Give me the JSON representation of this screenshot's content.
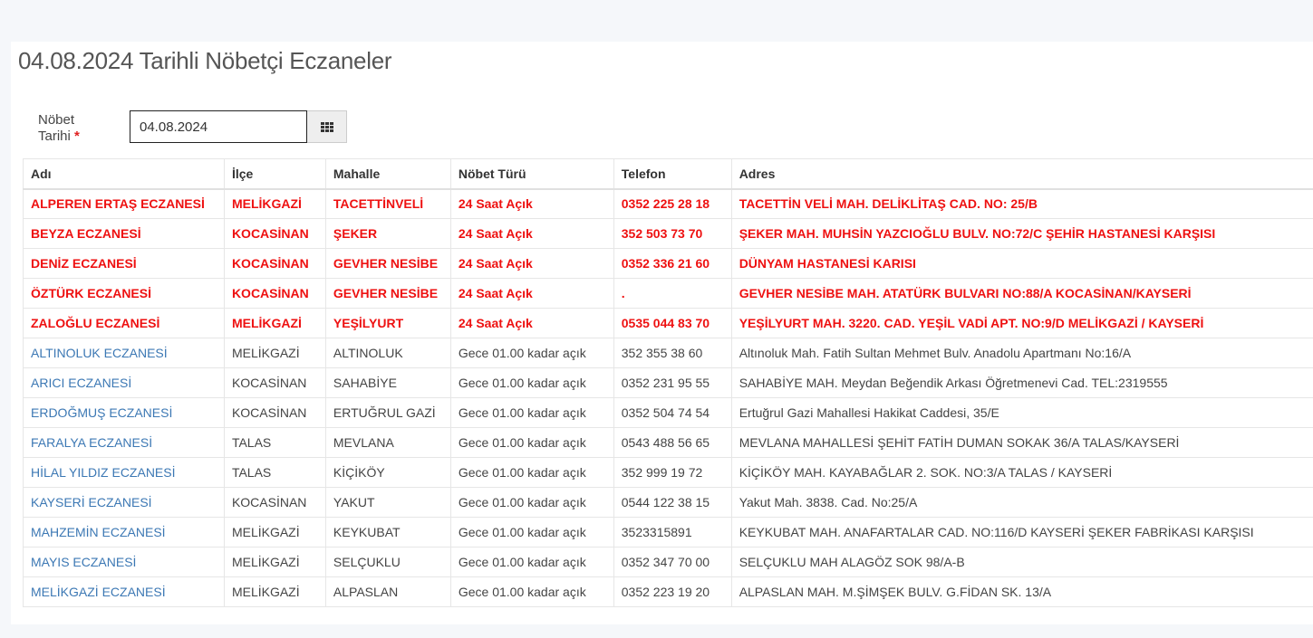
{
  "title": "04.08.2024 Tarihli Nöbetçi Eczaneler",
  "form": {
    "label_line1": "Nöbet",
    "label_line2": "Tarihi",
    "required_mark": "*",
    "date_value": "04.08.2024",
    "calendar_icon": "calendar-grid-icon"
  },
  "colors": {
    "open24_text": "#ee1111",
    "pharmacy_link": "#3c78b4"
  },
  "table": {
    "headers": [
      "Adı",
      "İlçe",
      "Mahalle",
      "Nöbet Türü",
      "Telefon",
      "Adres"
    ],
    "rows": [
      {
        "type": "open24",
        "cells": [
          "ALPEREN ERTAŞ ECZANESİ",
          "MELİKGAZİ",
          "TACETTİNVELİ",
          "24 Saat Açık",
          "0352 225 28 18",
          "TACETTİN VELİ MAH. DELİKLİTAŞ CAD. NO: 25/B"
        ]
      },
      {
        "type": "open24",
        "cells": [
          "BEYZA ECZANESİ",
          "KOCASİNAN",
          "ŞEKER",
          "24 Saat Açık",
          "352 503 73 70",
          "ŞEKER MAH. MUHSİN YAZCIOĞLU BULV. NO:72/C ŞEHİR HASTANESİ KARŞISI"
        ]
      },
      {
        "type": "open24",
        "cells": [
          "DENİZ ECZANESİ",
          "KOCASİNAN",
          "GEVHER NESİBE",
          "24 Saat Açık",
          "0352 336 21 60",
          "DÜNYAM HASTANESİ KARISI"
        ]
      },
      {
        "type": "open24",
        "cells": [
          "ÖZTÜRK ECZANESİ",
          "KOCASİNAN",
          "GEVHER NESİBE",
          "24 Saat Açık",
          ".",
          "GEVHER NESİBE MAH. ATATÜRK BULVARI NO:88/A KOCASİNAN/KAYSERİ"
        ]
      },
      {
        "type": "open24",
        "cells": [
          "ZALOĞLU ECZANESİ",
          "MELİKGAZİ",
          "YEŞİLYURT",
          "24 Saat Açık",
          "0535 044 83 70",
          "YEŞİLYURT MAH. 3220. CAD. YEŞİL VADİ APT. NO:9/D MELİKGAZİ / KAYSERİ"
        ]
      },
      {
        "type": "night",
        "cells": [
          "ALTINOLUK ECZANESİ",
          "MELİKGAZİ",
          "ALTINOLUK",
          "Gece 01.00 kadar açık",
          "352 355 38 60",
          "Altınoluk Mah. Fatih Sultan Mehmet Bulv. Anadolu Apartmanı No:16/A"
        ]
      },
      {
        "type": "night",
        "cells": [
          "ARICI ECZANESİ",
          "KOCASİNAN",
          "SAHABİYE",
          "Gece 01.00 kadar açık",
          "0352 231 95 55",
          "SAHABİYE MAH. Meydan Beğendik Arkası Öğretmenevi Cad. TEL:2319555"
        ]
      },
      {
        "type": "night",
        "cells": [
          "ERDOĞMUŞ ECZANESİ",
          "KOCASİNAN",
          "ERTUĞRUL GAZİ",
          "Gece 01.00 kadar açık",
          "0352 504 74 54",
          "Ertuğrul Gazi Mahallesi Hakikat Caddesi, 35/E"
        ]
      },
      {
        "type": "night",
        "cells": [
          "FARALYA ECZANESİ",
          "TALAS",
          "MEVLANA",
          "Gece 01.00 kadar açık",
          "0543 488 56 65",
          "MEVLANA MAHALLESİ ŞEHİT FATİH DUMAN SOKAK 36/A TALAS/KAYSERİ"
        ]
      },
      {
        "type": "night",
        "cells": [
          "HİLAL YILDIZ ECZANESİ",
          "TALAS",
          "KİÇİKÖY",
          "Gece 01.00 kadar açık",
          "352 999 19 72",
          "KİÇİKÖY MAH. KAYABAĞLAR 2. SOK. NO:3/A TALAS / KAYSERİ"
        ]
      },
      {
        "type": "night",
        "cells": [
          "KAYSERİ ECZANESİ",
          "KOCASİNAN",
          "YAKUT",
          "Gece 01.00 kadar açık",
          "0544 122 38 15",
          "Yakut Mah. 3838. Cad. No:25/A"
        ]
      },
      {
        "type": "night",
        "cells": [
          "MAHZEMİN ECZANESİ",
          "MELİKGAZİ",
          "KEYKUBAT",
          "Gece 01.00 kadar açık",
          "3523315891",
          "KEYKUBAT MAH. ANAFARTALAR CAD. NO:116/D KAYSERİ ŞEKER FABRİKASI KARŞISI"
        ]
      },
      {
        "type": "night",
        "cells": [
          "MAYIS ECZANESİ",
          "MELİKGAZİ",
          "SELÇUKLU",
          "Gece 01.00 kadar açık",
          "0352 347 70 00",
          "SELÇUKLU MAH ALAGÖZ SOK 98/A-B"
        ]
      },
      {
        "type": "night",
        "cells": [
          "MELİKGAZİ ECZANESİ",
          "MELİKGAZİ",
          "ALPASLAN",
          "Gece 01.00 kadar açık",
          "0352 223 19 20",
          "ALPASLAN MAH. M.ŞİMŞEK BULV. G.FİDAN SK. 13/A"
        ]
      }
    ]
  }
}
